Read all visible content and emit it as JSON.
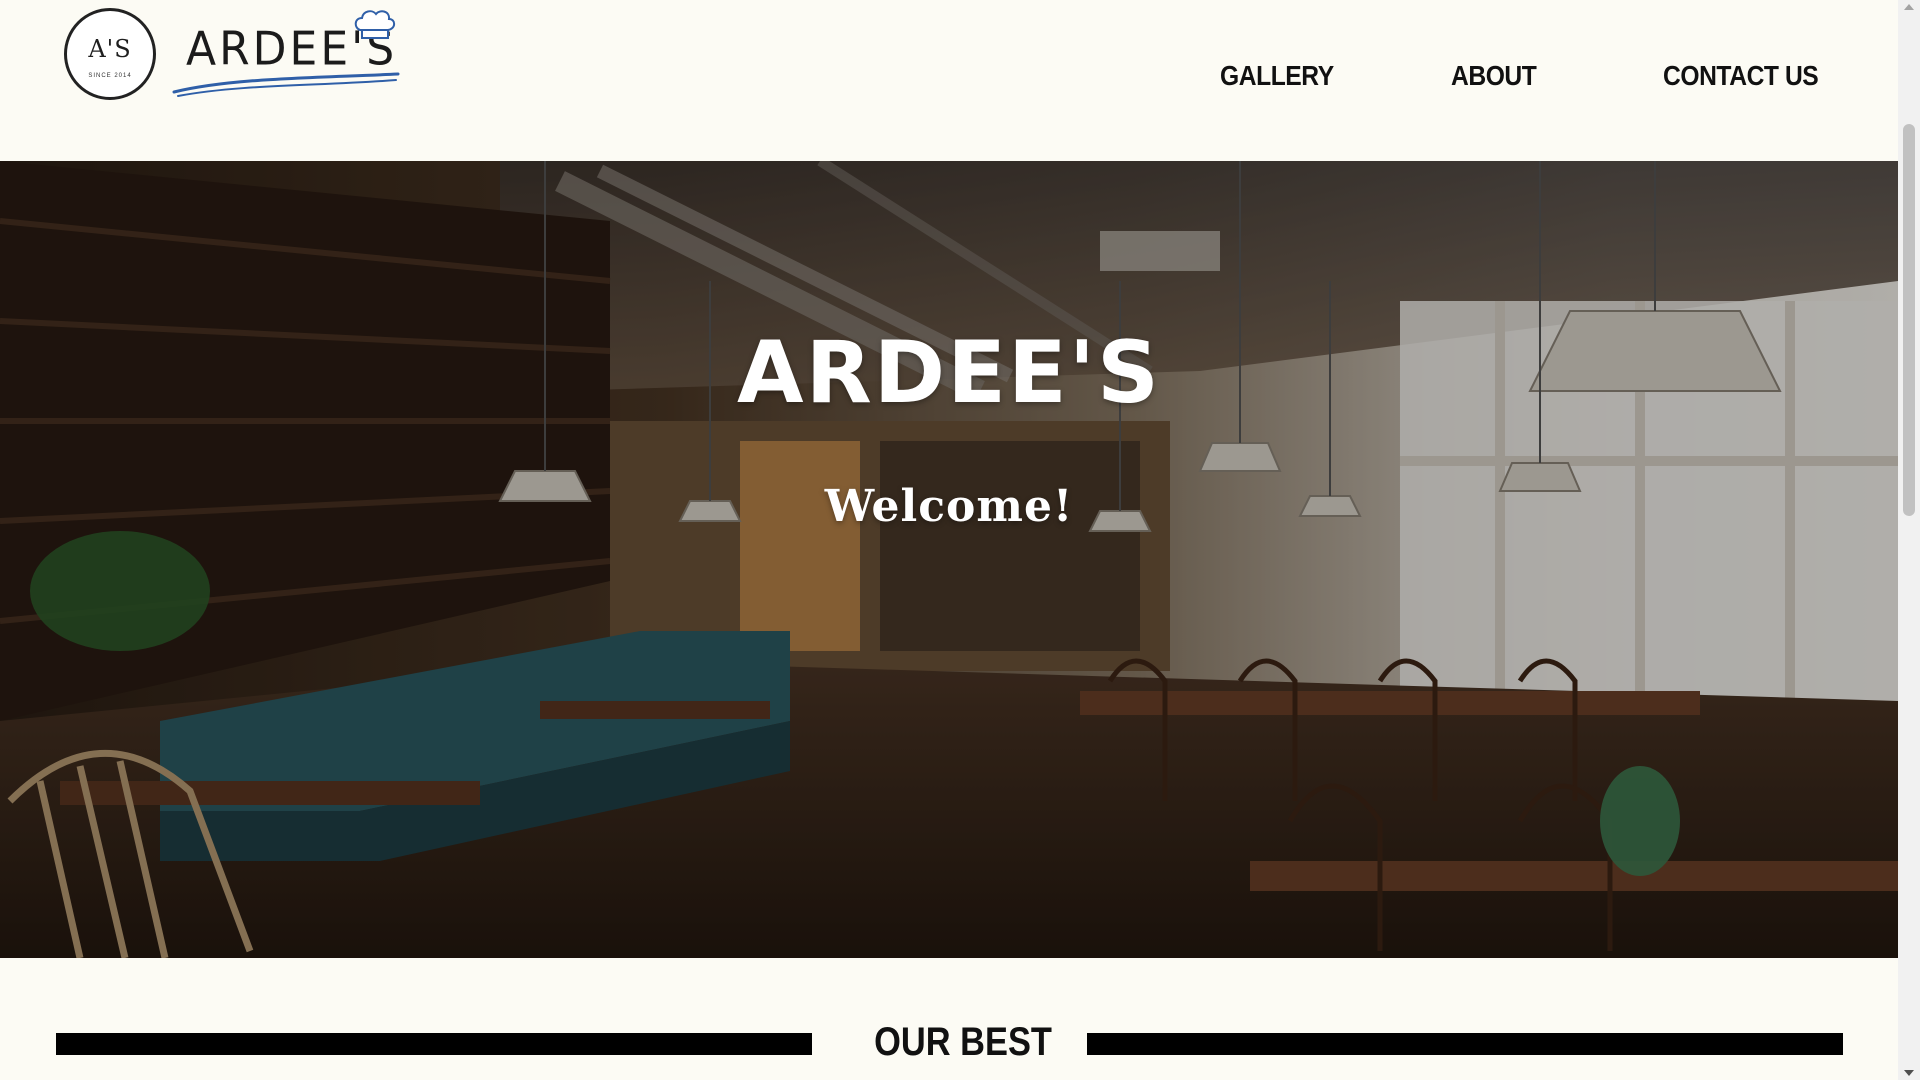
{
  "header": {
    "logo_monogram": "A'S",
    "logo_since": "SINCE 2014",
    "logo_wordmark": "ARDEE'S",
    "nav": [
      {
        "label": "GALLERY"
      },
      {
        "label": "ABOUT"
      },
      {
        "label": "CONTACT US"
      }
    ]
  },
  "hero": {
    "title": "ARDEE'S",
    "subtitle": "Welcome!"
  },
  "section": {
    "title": "OUR BEST"
  },
  "colors": {
    "page_bg": "#fcfbf4",
    "text": "#111111",
    "brand_blue": "#2f5fa8",
    "rule": "#000000"
  },
  "icons": {
    "chef_hat": "chef-hat-icon",
    "scroll_up": "scroll-up-arrow-icon",
    "scroll_down": "scroll-down-arrow-icon"
  }
}
